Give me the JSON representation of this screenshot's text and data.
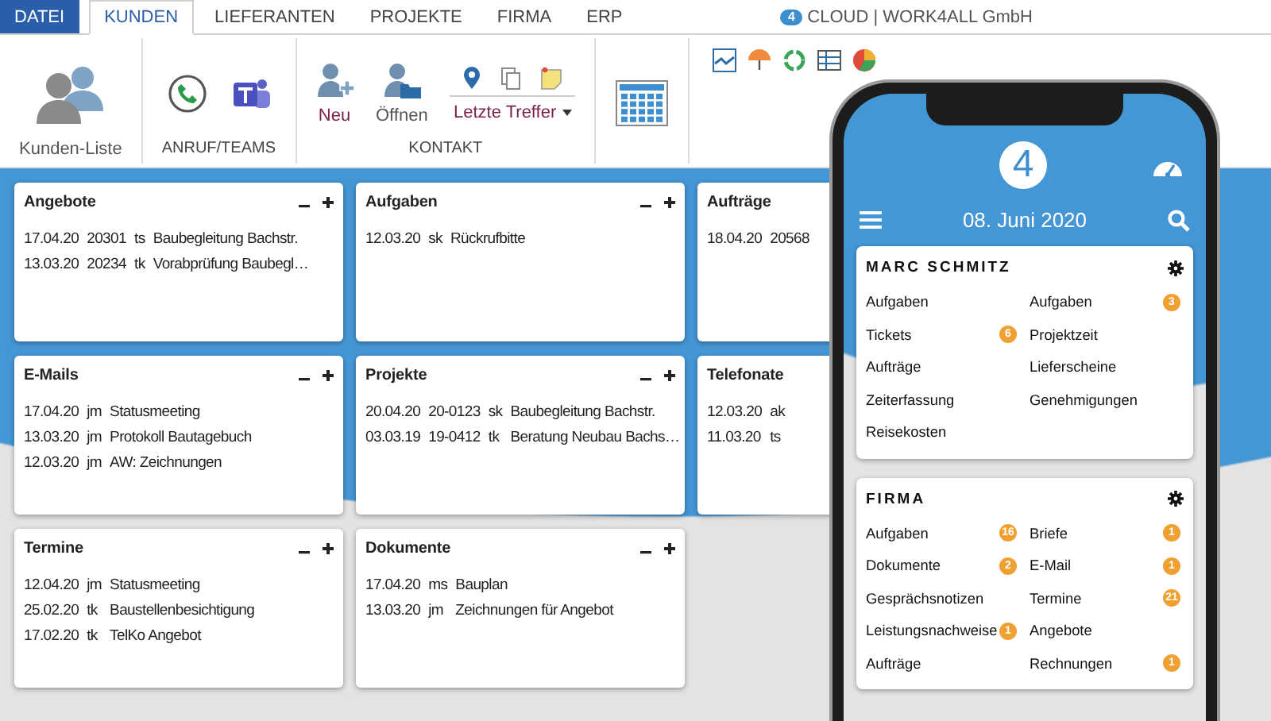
{
  "tabs": [
    {
      "label": "DATEI",
      "kind": "file",
      "selected": false
    },
    {
      "label": "KUNDEN",
      "kind": "tab",
      "selected": true
    },
    {
      "label": "LIEFERANTEN",
      "kind": "tab",
      "selected": false
    },
    {
      "label": "PROJEKTE",
      "kind": "tab",
      "selected": false
    },
    {
      "label": "FIRMA",
      "kind": "tab",
      "selected": false
    },
    {
      "label": "ERP",
      "kind": "tab",
      "selected": false
    }
  ],
  "account": {
    "badge": "4",
    "label": "CLOUD | WORK4ALL GmbH"
  },
  "ribbon": {
    "groups": [
      {
        "buttons": [
          {
            "kind": "button",
            "label": "Kunden-Liste",
            "highlight": false
          }
        ]
      },
      {
        "label": "ANRUF/TEAMS",
        "buttons": [
          {
            "kind": "icon"
          },
          {
            "kind": "icon"
          }
        ]
      },
      {
        "label": "KONTAKT",
        "buttons": [
          {
            "kind": "button",
            "label": "Neu",
            "highlight": true
          },
          {
            "kind": "button",
            "label": "Öffnen",
            "highlight": false
          },
          {
            "kind": "dropdown",
            "label": "Letzte Treffer",
            "highlight": true
          }
        ]
      },
      {
        "buttons": [
          {
            "kind": "icon"
          }
        ]
      },
      {
        "buttons": [
          {
            "kind": "icon"
          },
          {
            "kind": "icon"
          },
          {
            "kind": "icon"
          },
          {
            "kind": "icon"
          },
          {
            "kind": "icon"
          }
        ]
      }
    ]
  },
  "cards": [
    {
      "title": "Angebote",
      "clipped": false,
      "rows": [
        [
          "17.04.20",
          "20301",
          "ts",
          "Baubegleitung Bachstr."
        ],
        [
          "13.03.20",
          "20234",
          "tk",
          "Vorabprüfung Baubegl…"
        ]
      ]
    },
    {
      "title": "Aufgaben",
      "clipped": false,
      "rows": [
        [
          "12.03.20",
          "sk",
          "Rückrufbitte"
        ]
      ]
    },
    {
      "title": "Aufträge",
      "clipped": true,
      "rows": [
        [
          "18.04.20",
          "20568"
        ]
      ]
    },
    {
      "title": "E-Mails",
      "clipped": false,
      "rows": [
        [
          "17.04.20",
          "jm",
          "Statusmeeting"
        ],
        [
          "13.03.20",
          "jm",
          "Protokoll Bautagebuch"
        ],
        [
          "12.03.20",
          "jm",
          "AW: Zeichnungen"
        ]
      ]
    },
    {
      "title": "Projekte",
      "clipped": false,
      "rows": [
        [
          "20.04.20",
          "20-0123",
          "sk",
          "Baubegleitung Bachstr."
        ],
        [
          "03.03.19",
          "19-0412",
          "tk",
          "Beratung Neubau Bachs…"
        ]
      ]
    },
    {
      "title": "Telefonate",
      "clipped": true,
      "rows": [
        [
          "12.03.20",
          "ak"
        ],
        [
          "11.03.20",
          "ts"
        ]
      ]
    },
    {
      "title": "Termine",
      "clipped": false,
      "rows": [
        [
          "12.04.20",
          "jm",
          "Statusmeeting"
        ],
        [
          "25.02.20",
          "tk",
          "Baustellenbesichtigung"
        ],
        [
          "17.02.20",
          "tk",
          "TelKo Angebot"
        ]
      ]
    },
    {
      "title": "Dokumente",
      "clipped": false,
      "rows": [
        [
          "17.04.20",
          "ms",
          "Bauplan"
        ],
        [
          "13.03.20",
          "jm",
          "Zeichnungen für Angebot"
        ]
      ]
    }
  ],
  "phone": {
    "logo": "4",
    "date": "08. Juni 2020",
    "panels": [
      {
        "title": "MARC SCHMITZ",
        "items": [
          {
            "label": "Aufgaben"
          },
          {
            "label": "Aufgaben",
            "badge": "3"
          },
          {
            "label": "Tickets",
            "badge": "6"
          },
          {
            "label": "Projektzeit"
          },
          {
            "label": "Aufträge"
          },
          {
            "label": "Lieferscheine"
          },
          {
            "label": "Zeiterfassung"
          },
          {
            "label": "Genehmigungen"
          },
          {
            "label": "Reisekosten"
          }
        ]
      },
      {
        "title": "FIRMA",
        "items": [
          {
            "label": "Aufgaben",
            "badge": "16"
          },
          {
            "label": "Briefe",
            "badge": "1"
          },
          {
            "label": "Dokumente",
            "badge": "2"
          },
          {
            "label": "E-Mail",
            "badge": "1"
          },
          {
            "label": "Gesprächsnotizen"
          },
          {
            "label": "Termine",
            "badge": "21"
          },
          {
            "label": "Leistungsnachweise",
            "badge": "1"
          },
          {
            "label": "Angebote"
          },
          {
            "label": "Aufträge"
          },
          {
            "label": "Rechnungen",
            "badge": "1"
          }
        ]
      }
    ]
  }
}
